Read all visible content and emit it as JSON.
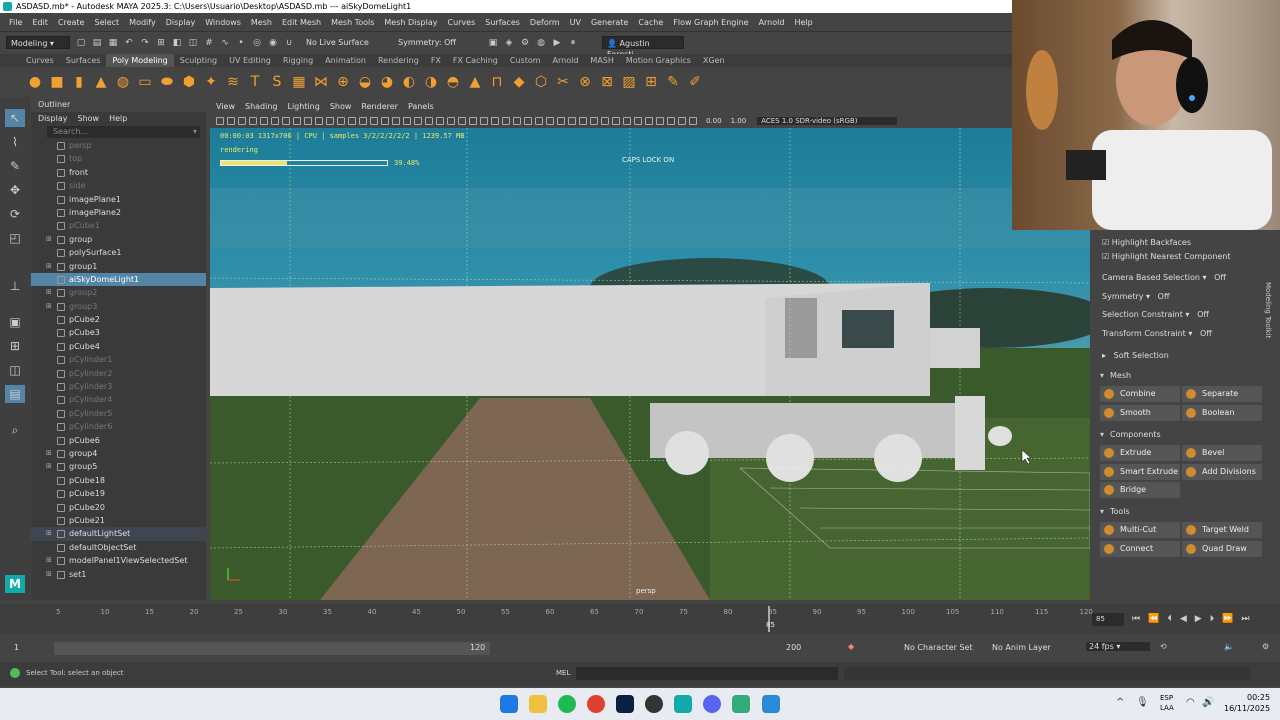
{
  "window": {
    "title": "ASDASD.mb* - Autodesk MAYA 2025.3: C:\\Users\\Usuario\\Desktop\\ASDASD.mb   ---   aiSkyDomeLight1"
  },
  "menubar": [
    "File",
    "Edit",
    "Create",
    "Select",
    "Modify",
    "Display",
    "Windows",
    "Mesh",
    "Edit Mesh",
    "Mesh Tools",
    "Mesh Display",
    "Curves",
    "Surfaces",
    "Deform",
    "UV",
    "Generate",
    "Cache",
    "Flow Graph Engine",
    "Arnold",
    "Help"
  ],
  "statusline": {
    "mode": "Modeling",
    "live_surface": "No Live Surface",
    "symmetry": "Symmetry: Off",
    "user": "Agustin Foresti..."
  },
  "shelf_tabs": [
    "Curves",
    "Surfaces",
    "Poly Modeling",
    "Sculpting",
    "UV Editing",
    "Rigging",
    "Animation",
    "Rendering",
    "FX",
    "FX Caching",
    "Custom",
    "Arnold",
    "MASH",
    "Motion Graphics",
    "XGen"
  ],
  "shelf_active": "Poly Modeling",
  "outliner": {
    "title": "Outliner",
    "menu": [
      "Display",
      "Show",
      "Help"
    ],
    "search_placeholder": "Search...",
    "rows": [
      {
        "label": "persp",
        "dim": true,
        "exp": false
      },
      {
        "label": "top",
        "dim": true,
        "exp": false
      },
      {
        "label": "front",
        "dim": false,
        "exp": false
      },
      {
        "label": "side",
        "dim": true,
        "exp": false
      },
      {
        "label": "imagePlane1",
        "dim": false,
        "exp": false
      },
      {
        "label": "imagePlane2",
        "dim": false,
        "exp": false
      },
      {
        "label": "pCube1",
        "dim": true,
        "exp": false
      },
      {
        "label": "group",
        "dim": false,
        "exp": true
      },
      {
        "label": "polySurface1",
        "dim": false,
        "exp": false
      },
      {
        "label": "group1",
        "dim": false,
        "exp": true
      },
      {
        "label": "aiSkyDomeLight1",
        "dim": false,
        "exp": false,
        "sel": true
      },
      {
        "label": "group2",
        "dim": true,
        "exp": true
      },
      {
        "label": "group3",
        "dim": true,
        "exp": true
      },
      {
        "label": "pCube2",
        "dim": false,
        "exp": false
      },
      {
        "label": "pCube3",
        "dim": false,
        "exp": false
      },
      {
        "label": "pCube4",
        "dim": false,
        "exp": false
      },
      {
        "label": "pCylinder1",
        "dim": true,
        "exp": false
      },
      {
        "label": "pCylinder2",
        "dim": true,
        "exp": false
      },
      {
        "label": "pCylinder3",
        "dim": true,
        "exp": false
      },
      {
        "label": "pCylinder4",
        "dim": true,
        "exp": false
      },
      {
        "label": "pCylinder5",
        "dim": true,
        "exp": false
      },
      {
        "label": "pCylinder6",
        "dim": true,
        "exp": false
      },
      {
        "label": "pCube6",
        "dim": false,
        "exp": false
      },
      {
        "label": "group4",
        "dim": false,
        "exp": true
      },
      {
        "label": "group5",
        "dim": false,
        "exp": true
      },
      {
        "label": "pCube18",
        "dim": false,
        "exp": false
      },
      {
        "label": "pCube19",
        "dim": false,
        "exp": false
      },
      {
        "label": "pCube20",
        "dim": false,
        "exp": false
      },
      {
        "label": "pCube21",
        "dim": false,
        "exp": false
      },
      {
        "label": "defaultLightSet",
        "dim": false,
        "exp": true,
        "set": true
      },
      {
        "label": "defaultObjectSet",
        "dim": false,
        "exp": false
      },
      {
        "label": "modelPanel1ViewSelectedSet",
        "dim": false,
        "exp": true
      },
      {
        "label": "set1",
        "dim": false,
        "exp": true
      }
    ]
  },
  "viewport": {
    "menu": [
      "View",
      "Shading",
      "Lighting",
      "Show",
      "Renderer",
      "Panels"
    ],
    "exposure": "0.00",
    "gamma": "1.00",
    "colorspace": "ACES 1.0 SDR-video (sRGB)",
    "hud_line1": "00:00:03 1317x706 | CPU | samples 3/2/2/2/2/2 | 1239.57 MB",
    "hud_line2": "rendering",
    "progress_pct": 39.48,
    "progress_text": "39.48%",
    "caps": "CAPS LOCK ON",
    "camera": "persp"
  },
  "toolkit": {
    "side_label": "Modeling Toolkit",
    "highlight_backfaces": "Highlight Backfaces",
    "highlight_nearest": "Highlight Nearest Component",
    "camera_based": "Camera Based Selection",
    "camera_based_val": "Off",
    "symmetry": "Symmetry",
    "symmetry_val": "Off",
    "sel_constraint": "Selection Constraint",
    "sel_constraint_val": "Off",
    "xf_constraint": "Transform Constraint",
    "xf_constraint_val": "Off",
    "soft_selection": "Soft Selection",
    "mesh_head": "Mesh",
    "combine": "Combine",
    "separate": "Separate",
    "smooth": "Smooth",
    "boolean": "Boolean",
    "components_head": "Components",
    "extrude": "Extrude",
    "bevel": "Bevel",
    "smart_extrude": "Smart Extrude",
    "add_divisions": "Add Divisions",
    "bridge": "Bridge",
    "tools_head": "Tools",
    "multicut": "Multi-Cut",
    "target_weld": "Target Weld",
    "connect": "Connect",
    "quad_draw": "Quad Draw"
  },
  "timeline": {
    "ticks": [
      "5",
      "10",
      "15",
      "20",
      "25",
      "30",
      "35",
      "40",
      "45",
      "50",
      "55",
      "60",
      "65",
      "70",
      "75",
      "80",
      "85",
      "90",
      "95",
      "100",
      "105",
      "110",
      "115",
      "120"
    ],
    "current": "85",
    "current_field": "85"
  },
  "range": {
    "start": "1",
    "start2": "1",
    "end_inner": "120",
    "end": "200",
    "char_set": "No Character Set",
    "anim_layer": "No Anim Layer",
    "fps": "24 fps"
  },
  "cmd": {
    "help": "Select Tool: select an object",
    "lang": "MEL"
  },
  "taskbar": {
    "lang": "ESP",
    "lang2": "LAA",
    "time": "00:25",
    "date": "16/11/2025"
  }
}
